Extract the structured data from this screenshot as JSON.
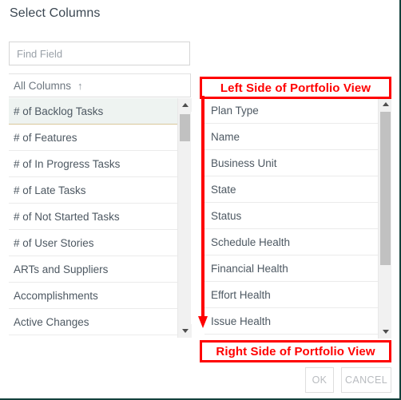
{
  "dialog": {
    "title": "Select Columns"
  },
  "search": {
    "placeholder": "Find Field",
    "value": ""
  },
  "left_panel": {
    "header_label": "All Columns",
    "sort_indicator": "↑",
    "sort_direction": "ascending",
    "selected_index": 0,
    "items": [
      {
        "label": "# of Backlog Tasks",
        "selected": true
      },
      {
        "label": "# of Features",
        "selected": false
      },
      {
        "label": "# of In Progress Tasks",
        "selected": false
      },
      {
        "label": "# of Late Tasks",
        "selected": false
      },
      {
        "label": "# of Not Started Tasks",
        "selected": false
      },
      {
        "label": "# of User Stories",
        "selected": false
      },
      {
        "label": "ARTs and Suppliers",
        "selected": false
      },
      {
        "label": "Accomplishments",
        "selected": false
      },
      {
        "label": "Active Changes",
        "selected": false
      }
    ],
    "scrollbar": {
      "up_arrow_icon": "triangle-up-icon",
      "down_arrow_icon": "triangle-down-icon"
    }
  },
  "right_panel": {
    "items": [
      {
        "label": "Plan Type"
      },
      {
        "label": "Name"
      },
      {
        "label": "Business Unit"
      },
      {
        "label": "State"
      },
      {
        "label": "Status"
      },
      {
        "label": "Schedule Health"
      },
      {
        "label": "Financial Health"
      },
      {
        "label": "Effort Health"
      },
      {
        "label": "Issue Health"
      }
    ],
    "scrollbar": {
      "up_arrow_icon": "triangle-up-icon",
      "down_arrow_icon": "triangle-down-icon"
    }
  },
  "annotations": {
    "top_label": "Left Side of Portfolio View",
    "bottom_label": "Right Side of Portfolio View",
    "arrow_icon": "arrow-down-icon",
    "color": "#ff0000"
  },
  "footer": {
    "ok_label": "OK",
    "cancel_label": "CANCEL",
    "ok_disabled": true,
    "cancel_disabled": true
  },
  "colors": {
    "selected_row_bg": "#eef3f1",
    "selected_row_underline": "#d9c89a",
    "text": "#4d5862",
    "muted_text": "#9aa1a8",
    "border": "#e2e2e2",
    "annotation_red": "#ff0000",
    "window_border": "#13413c"
  }
}
